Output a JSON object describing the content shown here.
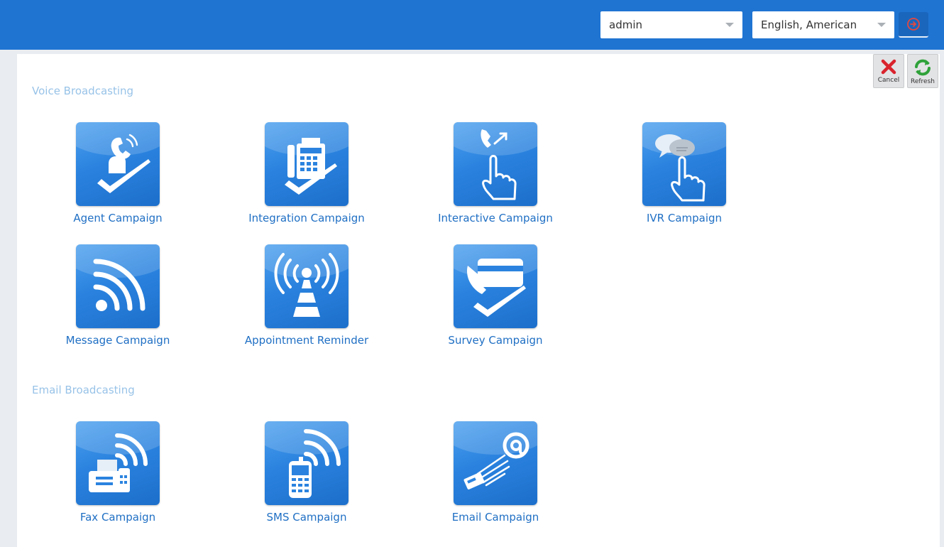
{
  "header": {
    "user_value": "admin",
    "language_value": "English, American"
  },
  "toolbar": {
    "cancel_label": "Cancel",
    "refresh_label": "Refresh"
  },
  "sections": [
    {
      "title": "Voice Broadcasting"
    },
    {
      "title": "Email Broadcasting"
    }
  ],
  "tiles": {
    "agent": "Agent Campaign",
    "integration": "Integration Campaign",
    "interactive": "Interactive Campaign",
    "ivr": "IVR Campaign",
    "message": "Message Campaign",
    "appointment": "Appointment Reminder",
    "survey": "Survey Campaign",
    "fax": "Fax Campaign",
    "sms": "SMS Campaign",
    "email": "Email Campaign"
  },
  "colors": {
    "header_bg": "#1f74d2",
    "tile_label": "#1f6fc4",
    "section_title": "#98c3e8",
    "cancel_x": "#d9232d",
    "refresh_arrows": "#2fa23a"
  },
  "icons": {
    "logout": "power-icon",
    "cancel": "red-x-icon",
    "refresh": "green-refresh-icon"
  }
}
